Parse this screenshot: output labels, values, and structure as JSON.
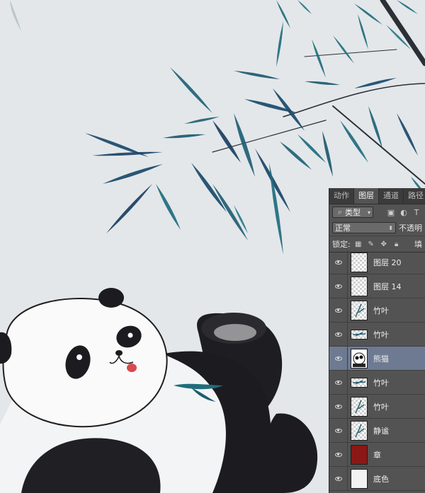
{
  "colors": {
    "canvas_bg": "#e3e7ea",
    "panel_bg": "#535353",
    "selected_layer_bg": "#6d7a91",
    "bamboo_teal": "#1f5f73",
    "bamboo_dark": "#1b3f5e",
    "seal_red": "#8c1717"
  },
  "panel": {
    "tabs": [
      "动作",
      "图层",
      "通道",
      "路径"
    ],
    "active_tab": "图层",
    "filter": {
      "label": "类型",
      "icon": "search-icon"
    },
    "blend_mode": "正常",
    "opacity_label": "不透明",
    "lock_label": "锁定:",
    "fill_label": "填",
    "layers": [
      {
        "name": "图层 20",
        "thumb": "transparent",
        "visible": true,
        "selected": false
      },
      {
        "name": "图层 14",
        "thumb": "transparent",
        "visible": true,
        "selected": false
      },
      {
        "name": "竹叶",
        "thumb": "bamboo",
        "visible": true,
        "selected": false
      },
      {
        "name": "竹叶",
        "thumb": "bamboo-wide",
        "visible": true,
        "selected": false
      },
      {
        "name": "熊猫",
        "thumb": "panda",
        "visible": true,
        "selected": true
      },
      {
        "name": "竹叶",
        "thumb": "bamboo-wide",
        "visible": true,
        "selected": false
      },
      {
        "name": "竹叶",
        "thumb": "bamboo",
        "visible": true,
        "selected": false
      },
      {
        "name": "静谧",
        "thumb": "text",
        "visible": true,
        "selected": false
      },
      {
        "name": "章",
        "thumb": "seal",
        "visible": true,
        "selected": false
      },
      {
        "name": "底色",
        "thumb": "white",
        "visible": true,
        "selected": false
      }
    ]
  }
}
